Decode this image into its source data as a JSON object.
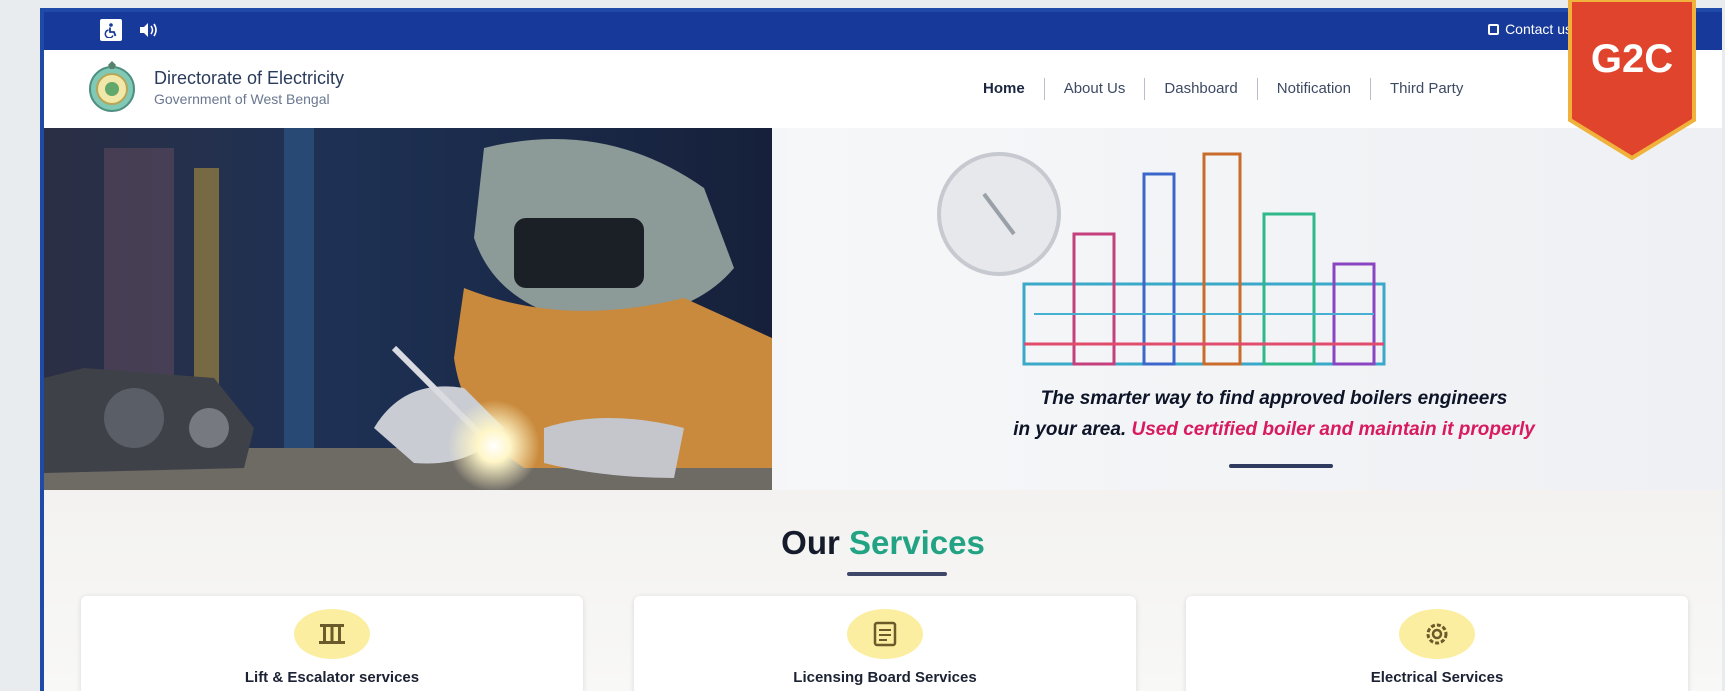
{
  "topbar": {
    "accessibility_icon": "wheelchair-icon",
    "sound_icon": "speaker-icon",
    "contact_label": "Contact us",
    "colors": {
      "bar": "#16399a",
      "tab": "#33c5d8"
    }
  },
  "header": {
    "org_name": "Directorate of Electricity",
    "org_sub": "Government of West Bengal",
    "logo_icon": "emblem-icon"
  },
  "nav": {
    "items": [
      {
        "label": "Home"
      },
      {
        "label": "About Us"
      },
      {
        "label": "Dashboard"
      },
      {
        "label": "Notification"
      },
      {
        "label": "Third Party"
      }
    ]
  },
  "hero": {
    "line1": "The smarter way to find approved boilers engineers",
    "line2_start": "in your area.",
    "line2_accent": "Used certified boiler and maintain it properly",
    "accent_color": "#d81a5e"
  },
  "services": {
    "title_a": "Our",
    "title_b": "Services",
    "accent_color": "#22a383",
    "cards": [
      {
        "title": "Lift & Escalator services",
        "icon": "lift-icon"
      },
      {
        "title": "Licensing Board Services",
        "icon": "certificate-icon"
      },
      {
        "title": "Electrical Services",
        "icon": "gear-icon"
      }
    ]
  },
  "badge": {
    "label": "G2C",
    "color": "#e0442c"
  }
}
